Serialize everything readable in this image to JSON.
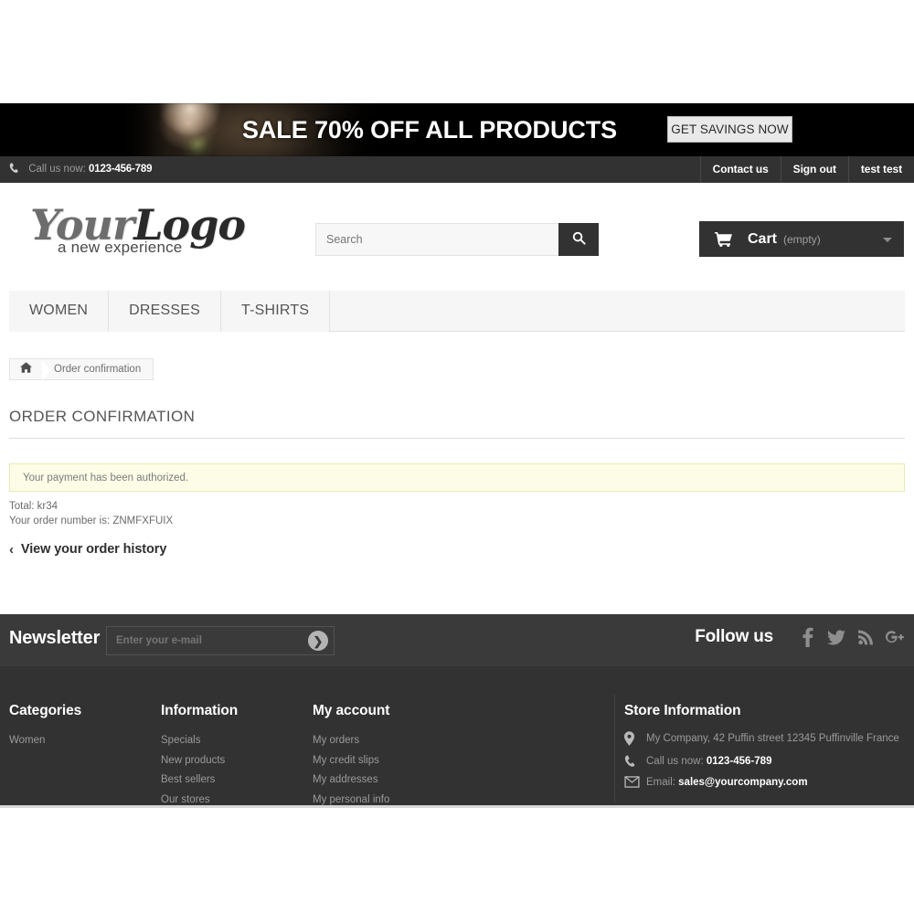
{
  "promo": {
    "headline": "SALE 70% OFF ALL PRODUCTS",
    "cta": "GET SAVINGS NOW"
  },
  "topbar": {
    "phone_label": "Call us now:",
    "phone_number": "0123-456-789",
    "links": [
      {
        "label": "Contact us"
      },
      {
        "label": "Sign out"
      },
      {
        "label": "test test"
      }
    ]
  },
  "header": {
    "logo_your": "Your",
    "logo_logo": "Logo",
    "logo_tagline": "a new experience",
    "search": {
      "placeholder": "Search",
      "value": ""
    },
    "cart": {
      "label": "Cart",
      "status": "(empty)"
    }
  },
  "mainnav": {
    "items": [
      {
        "label": "WOMEN"
      },
      {
        "label": "DRESSES"
      },
      {
        "label": "T-SHIRTS"
      }
    ]
  },
  "breadcrumb": {
    "home": "home-icon",
    "current": "Order confirmation"
  },
  "content": {
    "page_title": "ORDER CONFIRMATION",
    "alert": "Your payment has been authorized.",
    "total": "Total: kr34",
    "order_number": "Your order number is: ZNMFXFUIX",
    "history_link": "View your order history",
    "history_chevron": "‹"
  },
  "newsletter": {
    "title": "Newsletter",
    "placeholder": "Enter your e-mail",
    "value": "",
    "submit_glyph": "❯"
  },
  "follow": {
    "label": "Follow us",
    "networks": [
      {
        "name": "facebook-icon"
      },
      {
        "name": "twitter-icon"
      },
      {
        "name": "rss-icon"
      },
      {
        "name": "google-plus-icon"
      }
    ]
  },
  "footer": {
    "categories": {
      "heading": "Categories",
      "items": [
        {
          "label": "Women"
        }
      ]
    },
    "information": {
      "heading": "Information",
      "items": [
        {
          "label": "Specials"
        },
        {
          "label": "New products"
        },
        {
          "label": "Best sellers"
        },
        {
          "label": "Our stores"
        }
      ]
    },
    "my_account": {
      "heading": "My account",
      "items": [
        {
          "label": "My orders"
        },
        {
          "label": "My credit slips"
        },
        {
          "label": "My addresses"
        },
        {
          "label": "My personal info"
        }
      ]
    },
    "store_information": {
      "heading": "Store Information",
      "address": "My Company, 42 Puffin street 12345 Puffinville France",
      "phone_label": "Call us now:",
      "phone_number": "0123-456-789",
      "email_label": "Email:",
      "email": "sales@yourcompany.com"
    }
  },
  "colors": {
    "dark": "#333232",
    "newsletter_bg": "#3a3a3a",
    "alert_bg": "#fdfde7",
    "alert_border": "#e9e9b8",
    "nav_bg": "#f6f6f6",
    "muted_text": "#9a9a9a"
  }
}
